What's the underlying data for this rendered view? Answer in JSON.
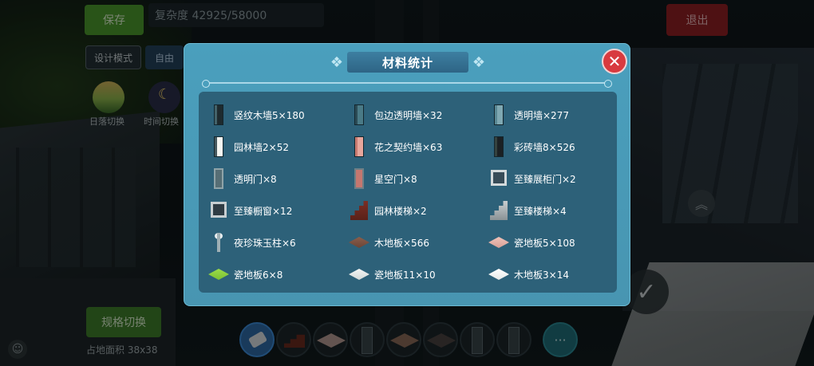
{
  "hud": {
    "save_label": "保存",
    "progress_text": "复杂度 42925/58000",
    "exit_label": "退出",
    "mode_label": "设计模式",
    "free_label": "自由",
    "sunset_label": "日落切换",
    "time_label": "时间切换",
    "layout_switch_label": "规格切换",
    "dims_text": "占地面积 38x38",
    "more_label": "···"
  },
  "dialog": {
    "title": "材料统计",
    "close_symbol": "✕",
    "items": [
      {
        "label": "竖纹木墙5×180",
        "icon": "wall-icon",
        "color": "#1e2a2e",
        "accent": "#44636a"
      },
      {
        "label": "包边透明墙×32",
        "icon": "wall-icon",
        "color": "#4a7a86",
        "accent": "#2b4b55"
      },
      {
        "label": "透明墙×277",
        "icon": "wall-icon",
        "color": "#7fa8b2",
        "accent": "#5a8894"
      },
      {
        "label": "园林墙2×52",
        "icon": "wall-icon",
        "color": "#f4f6f2",
        "accent": "#46595f"
      },
      {
        "label": "花之契约墙×63",
        "icon": "wall-icon",
        "color": "#e7a69c",
        "accent": "#c77a70"
      },
      {
        "label": "彩砖墙8×526",
        "icon": "wall-icon",
        "color": "#1b2023",
        "accent": "#35423f"
      },
      {
        "label": "透明门×8",
        "icon": "door-icon",
        "color": "#8fa3a8",
        "accent": "#566e75"
      },
      {
        "label": "星空门×8",
        "icon": "door-icon",
        "color": "#6e7f86",
        "accent": "#c5776f"
      },
      {
        "label": "至臻展柜门×2",
        "icon": "frame-icon",
        "color": "#d3d9db",
        "accent": "#374c58"
      },
      {
        "label": "至臻橱窗×12",
        "icon": "frame-icon",
        "color": "#c7ced1",
        "accent": "#2f3c44"
      },
      {
        "label": "园林楼梯×2",
        "icon": "stair-icon",
        "color": "#7a2f25",
        "accent": "#5a2119"
      },
      {
        "label": "至臻楼梯×4",
        "icon": "stair-icon",
        "color": "#c9ced0",
        "accent": "#8a9295"
      },
      {
        "label": "夜珍珠玉柱×6",
        "icon": "lamp-icon",
        "color": "#9fb0b5",
        "accent": "#e9eef0"
      },
      {
        "label": "木地板×566",
        "icon": "tile-icon",
        "color": "#8a5e4c",
        "accent": "#6b4536"
      },
      {
        "label": "瓷地板5×108",
        "icon": "tile-icon",
        "color": "#f0c2b8",
        "accent": "#d8a096"
      },
      {
        "label": "瓷地板6×8",
        "icon": "tile-icon",
        "color": "#9bdc4a",
        "accent": "#7cc032"
      },
      {
        "label": "瓷地板11×10",
        "icon": "tile-icon",
        "color": "#f3f5f4",
        "accent": "#d4d9d8"
      },
      {
        "label": "木地板3×14",
        "icon": "tile-icon",
        "color": "#ffffff",
        "accent": "#e5e8e7"
      }
    ]
  }
}
